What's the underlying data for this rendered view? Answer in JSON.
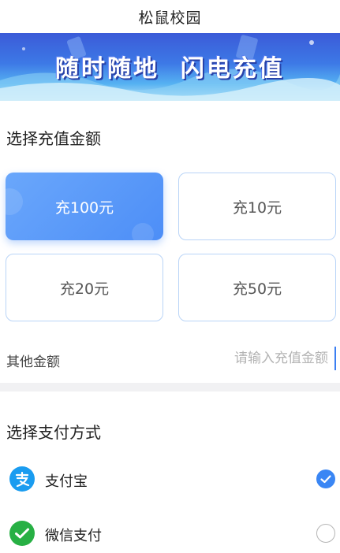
{
  "header": {
    "title": "松鼠校园"
  },
  "banner": {
    "text": "随时随地  闪电充值"
  },
  "amount_section": {
    "title": "选择充值金额",
    "options": [
      {
        "label": "充100元",
        "selected": true
      },
      {
        "label": "充10元",
        "selected": false
      },
      {
        "label": "充20元",
        "selected": false
      },
      {
        "label": "充50元",
        "selected": false
      }
    ],
    "other": {
      "label": "其他金额",
      "placeholder": "请输入充值金额",
      "value": ""
    }
  },
  "payment_section": {
    "title": "选择支付方式",
    "methods": [
      {
        "label": "支付宝",
        "icon": "alipay-icon",
        "color": "#1a9cf0",
        "selected": true
      },
      {
        "label": "微信支付",
        "icon": "wechat-pay-icon",
        "color": "#27b044",
        "selected": false
      }
    ]
  },
  "colors": {
    "accent": "#3a86f4",
    "card_border": "#b9d4f7"
  }
}
